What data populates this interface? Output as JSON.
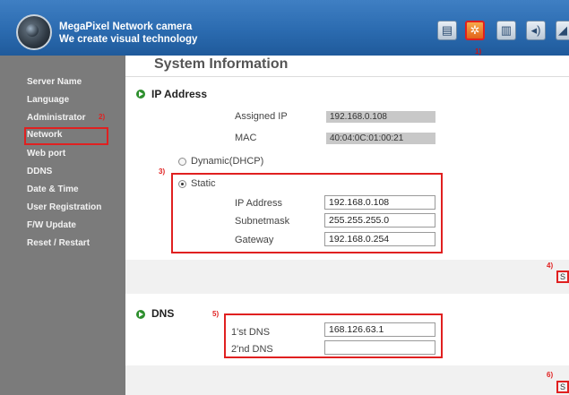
{
  "header": {
    "brand_line1": "MegaPixel Network camera",
    "brand_line2": "We create visual technology",
    "toolbar_number": "1)",
    "toolbar": [
      {
        "icon": "document-icon",
        "active": false
      },
      {
        "icon": "gear-icon",
        "active": true
      },
      {
        "icon": "film-icon",
        "active": false
      },
      {
        "icon": "speaker-icon",
        "active": false
      },
      {
        "icon": "camera-icon",
        "active": false
      }
    ]
  },
  "sidebar": {
    "number": "2)",
    "items": [
      {
        "label": "Server Name"
      },
      {
        "label": "Language"
      },
      {
        "label": "Administrator"
      },
      {
        "label": "Network"
      },
      {
        "label": "Web port"
      },
      {
        "label": "DDNS"
      },
      {
        "label": "Date & Time"
      },
      {
        "label": "User Registration"
      },
      {
        "label": "F/W Update"
      },
      {
        "label": "Reset / Restart"
      }
    ]
  },
  "main": {
    "title": "System Information",
    "ip_section": {
      "title": "IP Address",
      "assigned_ip_label": "Assigned IP",
      "assigned_ip_value": "192.168.0.108",
      "mac_label": "MAC",
      "mac_value": "40:04:0C:01:00:21",
      "dhcp_label": "Dynamic(DHCP)",
      "static_label": "Static",
      "static_number": "3)",
      "ip_label": "IP Address",
      "ip_value": "192.168.0.108",
      "subnet_label": "Subnetmask",
      "subnet_value": "255.255.255.0",
      "gateway_label": "Gateway",
      "gateway_value": "192.168.0.254",
      "save_number": "4)",
      "save_label": "S"
    },
    "dns_section": {
      "title": "DNS",
      "number": "5)",
      "dns1_label": "1'st DNS",
      "dns1_value": "168.126.63.1",
      "dns2_label": "2'nd DNS",
      "dns2_value": "",
      "save_number": "6)",
      "save_label": "S"
    }
  }
}
